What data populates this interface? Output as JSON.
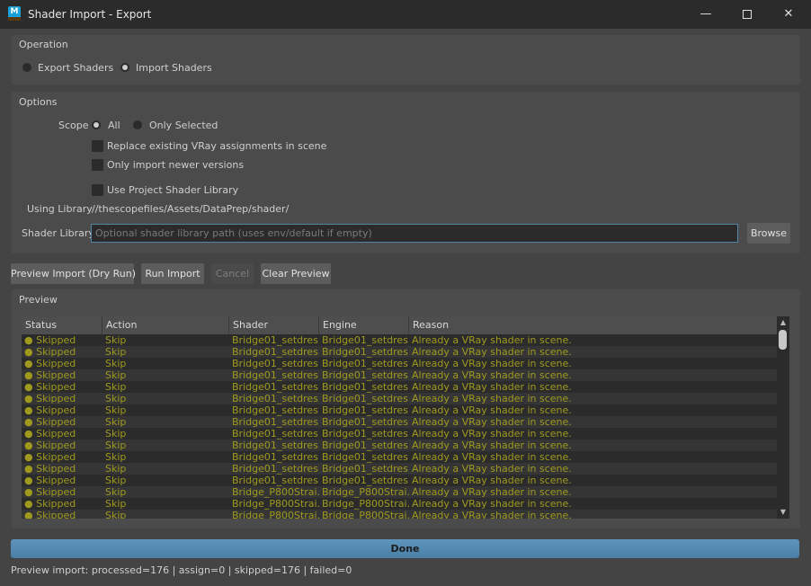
{
  "window": {
    "title": "Shader Import - Export",
    "app_icon_letter": "M",
    "minimize_glyph": "—",
    "close_glyph": "✕"
  },
  "operation": {
    "label": "Operation",
    "export_label": "Export Shaders",
    "import_label": "Import Shaders",
    "selected": "Import Shaders"
  },
  "options": {
    "label": "Options",
    "scope_label": "Scope",
    "scope_all": "All",
    "scope_selected": "Only Selected",
    "scope_value": "All",
    "replace_label": "Replace existing VRay assignments in scene",
    "replace_checked": false,
    "newer_label": "Only import newer versions",
    "newer_checked": false,
    "project_lib_label": "Use Project Shader Library",
    "project_lib_checked": false,
    "using_library_label": "Using Library",
    "using_library_value": "//thescopefiles/Assets/DataPrep/shader/",
    "shader_library_label": "Shader Library",
    "shader_library_value": "",
    "shader_library_placeholder": "Optional shader library path (uses env/default if empty)",
    "browse_label": "Browse"
  },
  "actions": {
    "preview_label": "Preview Import (Dry Run)",
    "run_label": "Run Import",
    "cancel_label": "Cancel",
    "cancel_enabled": false,
    "clear_label": "Clear Preview"
  },
  "preview": {
    "label": "Preview",
    "columns": [
      "Status",
      "Action",
      "Shader",
      "Engine",
      "Reason"
    ],
    "rows": [
      [
        "● Skipped",
        "Skip",
        "Bridge01_setdres...",
        "Bridge01_setdres...",
        "Already a VRay shader in scene."
      ],
      [
        "● Skipped",
        "Skip",
        "Bridge01_setdres...",
        "Bridge01_setdres...",
        "Already a VRay shader in scene."
      ],
      [
        "● Skipped",
        "Skip",
        "Bridge01_setdres...",
        "Bridge01_setdres...",
        "Already a VRay shader in scene."
      ],
      [
        "● Skipped",
        "Skip",
        "Bridge01_setdres...",
        "Bridge01_setdres...",
        "Already a VRay shader in scene."
      ],
      [
        "● Skipped",
        "Skip",
        "Bridge01_setdres...",
        "Bridge01_setdres...",
        "Already a VRay shader in scene."
      ],
      [
        "● Skipped",
        "Skip",
        "Bridge01_setdres...",
        "Bridge01_setdres...",
        "Already a VRay shader in scene."
      ],
      [
        "● Skipped",
        "Skip",
        "Bridge01_setdres...",
        "Bridge01_setdres...",
        "Already a VRay shader in scene."
      ],
      [
        "● Skipped",
        "Skip",
        "Bridge01_setdres...",
        "Bridge01_setdres...",
        "Already a VRay shader in scene."
      ],
      [
        "● Skipped",
        "Skip",
        "Bridge01_setdres...",
        "Bridge01_setdres...",
        "Already a VRay shader in scene."
      ],
      [
        "● Skipped",
        "Skip",
        "Bridge01_setdres...",
        "Bridge01_setdres...",
        "Already a VRay shader in scene."
      ],
      [
        "● Skipped",
        "Skip",
        "Bridge01_setdres...",
        "Bridge01_setdres...",
        "Already a VRay shader in scene."
      ],
      [
        "● Skipped",
        "Skip",
        "Bridge01_setdres...",
        "Bridge01_setdres...",
        "Already a VRay shader in scene."
      ],
      [
        "● Skipped",
        "Skip",
        "Bridge01_setdres...",
        "Bridge01_setdres...",
        "Already a VRay shader in scene."
      ],
      [
        "● Skipped",
        "Skip",
        "Bridge_P800Strai...",
        "Bridge_P800Strai...",
        "Already a VRay shader in scene."
      ],
      [
        "● Skipped",
        "Skip",
        "Bridge_P800Strai...",
        "Bridge_P800Strai...",
        "Already a VRay shader in scene."
      ],
      [
        "● Skipped",
        "Skip",
        "Bridge_P800Strai...",
        "Bridge_P800Strai...",
        "Already a VRay shader in scene."
      ]
    ],
    "row_color": "#9f9a1e"
  },
  "progress": {
    "label": "Done",
    "percent": 100,
    "color": "#5285a6"
  },
  "status": "Preview import: processed=176 | assign=0 | skipped=176 | failed=0"
}
